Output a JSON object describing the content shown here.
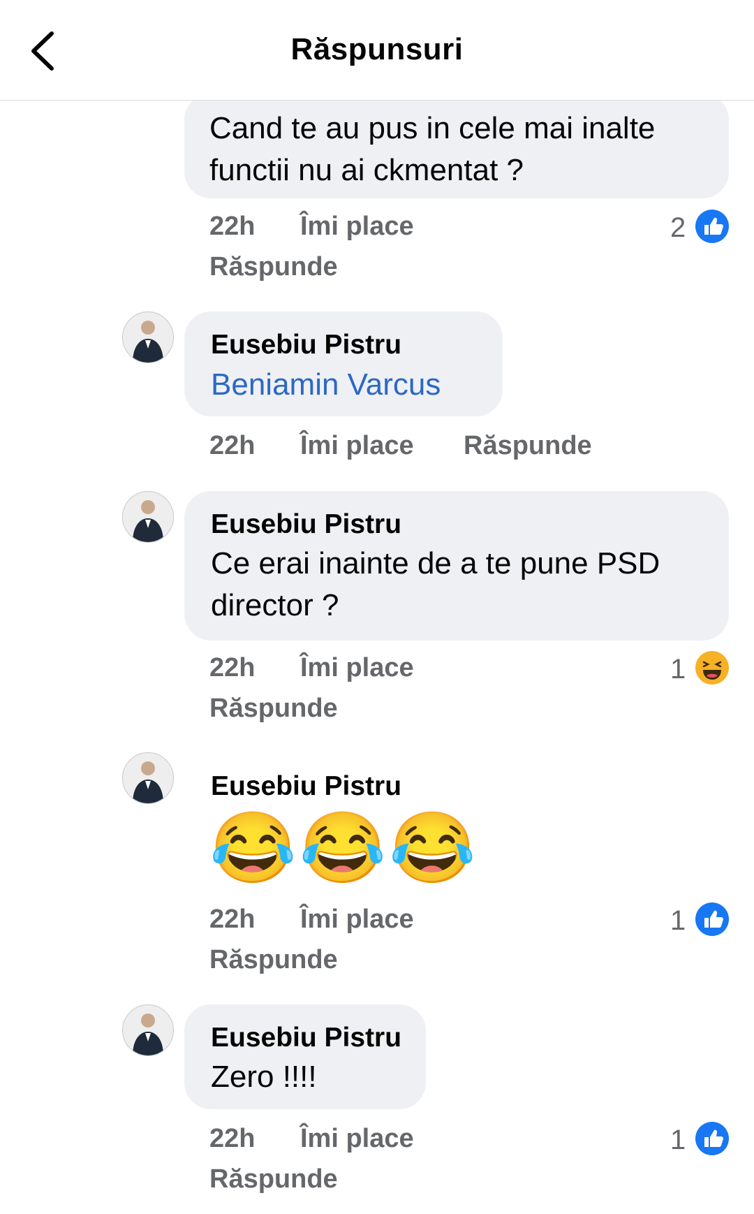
{
  "header": {
    "title": "Răspunsuri"
  },
  "comments": [
    {
      "text": "Cand te au pus in cele mai inalte functii nu ai ckmentat ?",
      "time": "22h",
      "like": "Îmi place",
      "reply": "Răspunde",
      "reaction": {
        "count": "2",
        "icon": "like-icon"
      }
    },
    {
      "author": "Eusebiu Pistru",
      "mention": "Beniamin Varcus",
      "time": "22h",
      "like": "Îmi place",
      "reply": "Răspunde"
    },
    {
      "author": "Eusebiu Pistru",
      "text": "Ce erai inainte de a te pune PSD director ?",
      "time": "22h",
      "like": "Îmi place",
      "reply": "Răspunde",
      "reaction": {
        "count": "1",
        "icon": "haha-icon"
      }
    },
    {
      "author": "Eusebiu Pistru",
      "emoji": "😂😂😂",
      "time": "22h",
      "like": "Îmi place",
      "reply": "Răspunde",
      "reaction": {
        "count": "1",
        "icon": "like-icon"
      }
    },
    {
      "author": "Eusebiu Pistru",
      "text": "Zero !!!!",
      "time": "22h",
      "like": "Îmi place",
      "reply": "Răspunde",
      "reaction": {
        "count": "1",
        "icon": "like-icon"
      }
    }
  ],
  "colors": {
    "like": "#1877f2",
    "haha": "#f7b125",
    "link": "#2c68c4",
    "bubble": "#eff0f3",
    "meta": "#65676b"
  }
}
